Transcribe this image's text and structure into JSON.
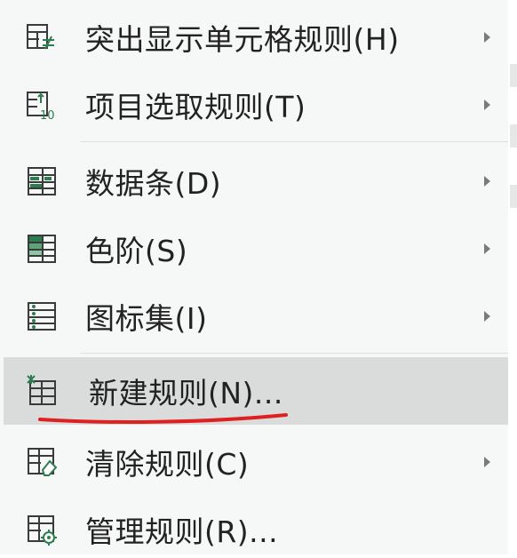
{
  "menu": {
    "items": [
      {
        "label": "突出显示单元格规则(H)",
        "icon": "highlight-cells-rules-icon",
        "has_submenu": true
      },
      {
        "label": "项目选取规则(T)",
        "icon": "top-bottom-rules-icon",
        "has_submenu": true
      },
      {
        "label": "数据条(D)",
        "icon": "data-bars-icon",
        "has_submenu": true
      },
      {
        "label": "色阶(S)",
        "icon": "color-scales-icon",
        "has_submenu": true
      },
      {
        "label": "图标集(I)",
        "icon": "icon-sets-icon",
        "has_submenu": true
      },
      {
        "label": "新建规则(N)...",
        "icon": "new-rule-icon",
        "has_submenu": false,
        "highlighted": true
      },
      {
        "label": "清除规则(C)",
        "icon": "clear-rules-icon",
        "has_submenu": true
      },
      {
        "label": "管理规则(R)...",
        "icon": "manage-rules-icon",
        "has_submenu": false
      }
    ]
  },
  "colors": {
    "icon_green": "#2e7d4f",
    "icon_dark": "#3a3a3a",
    "annotation_red": "#e02020",
    "highlight_bg": "#dadcdc"
  }
}
